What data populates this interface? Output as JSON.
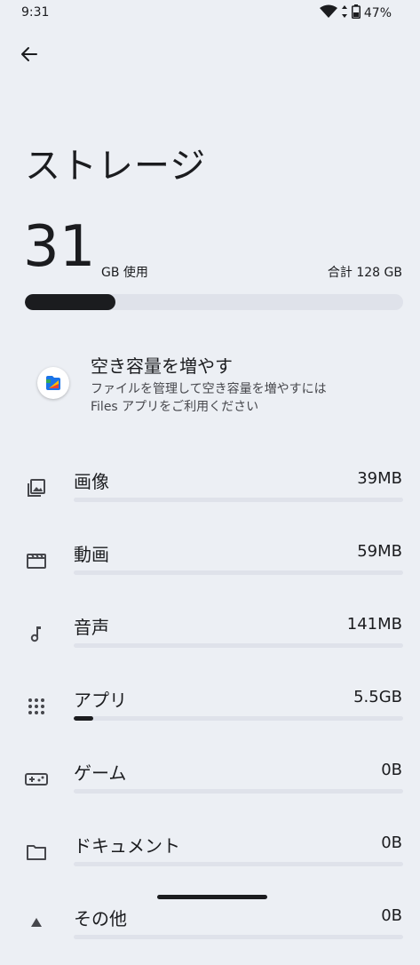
{
  "status_bar": {
    "time": "9:31",
    "battery": "47%"
  },
  "page": {
    "title": "ストレージ"
  },
  "summary": {
    "used_value": "31",
    "used_unit": "GB 使用",
    "total": "合計 128 GB",
    "used_fraction": 0.24
  },
  "promo": {
    "title": "空き容量を増やす",
    "description": "ファイルを管理して空き容量を増やすには\nFiles アプリをご利用ください"
  },
  "categories": [
    {
      "label": "画像",
      "size": "39MB",
      "fraction": 0.0,
      "icon": "image-icon"
    },
    {
      "label": "動画",
      "size": "59MB",
      "fraction": 0.0,
      "icon": "video-icon"
    },
    {
      "label": "音声",
      "size": "141MB",
      "fraction": 0.0,
      "icon": "music-note-icon"
    },
    {
      "label": "アプリ",
      "size": "5.5GB",
      "fraction": 0.06,
      "icon": "apps-icon"
    },
    {
      "label": "ゲーム",
      "size": "0B",
      "fraction": 0.0,
      "icon": "gamepad-icon"
    },
    {
      "label": "ドキュメント",
      "size": "0B",
      "fraction": 0.0,
      "icon": "folder-icon"
    },
    {
      "label": "その他",
      "size": "0B",
      "fraction": 0.0,
      "icon": "other-icon"
    }
  ],
  "colors": {
    "background": "#eceff4",
    "accent": "#1b1c1f",
    "track": "#dfe2ea"
  }
}
